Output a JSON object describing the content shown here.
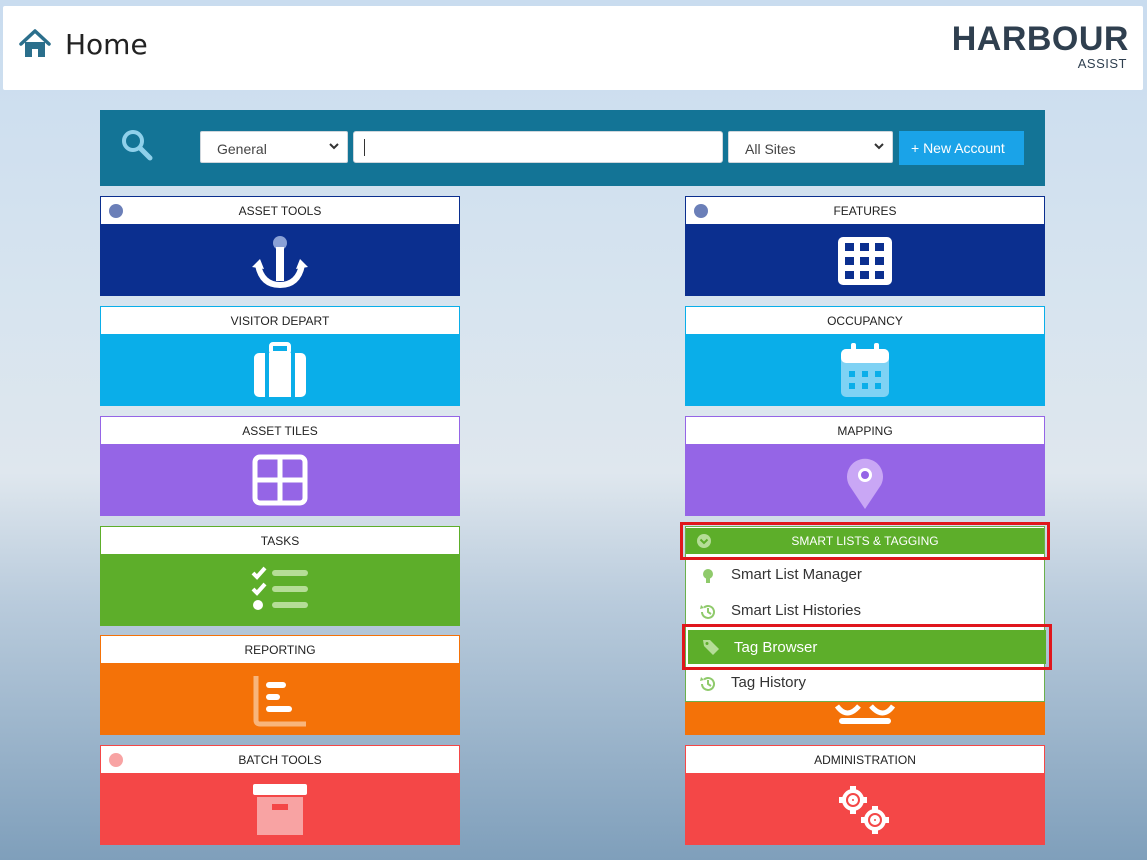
{
  "header": {
    "title": "Home",
    "logo_main": "HARBOUR",
    "logo_sub": "ASSIST"
  },
  "search": {
    "category": "General",
    "query": "",
    "sites": "All Sites",
    "new_account_label": "+ New Account"
  },
  "tiles": {
    "asset_tools": {
      "label": "ASSET TOOLS",
      "color": "#0b2f8f",
      "icon": "anchor-icon"
    },
    "features": {
      "label": "FEATURES",
      "color": "#0b2f8f",
      "icon": "grid-icon"
    },
    "visitor_depart": {
      "label": "VISITOR DEPART",
      "color": "#0aaee9",
      "icon": "suitcase-icon"
    },
    "occupancy": {
      "label": "OCCUPANCY",
      "color": "#0aaee9",
      "icon": "calendar-icon"
    },
    "asset_tiles": {
      "label": "ASSET TILES",
      "color": "#9565e6",
      "icon": "tiles-icon"
    },
    "mapping": {
      "label": "MAPPING",
      "color": "#9565e6",
      "icon": "map-pin-icon"
    },
    "tasks": {
      "label": "TASKS",
      "color": "#5dae2a",
      "icon": "checklist-icon"
    },
    "reporting": {
      "label": "REPORTING",
      "color": "#f47208",
      "icon": "bar-chart-icon"
    },
    "batch_tools": {
      "label": "BATCH TOOLS",
      "color": "#f44747",
      "icon": "archive-box-icon"
    },
    "administration": {
      "label": "ADMINISTRATION",
      "color": "#f44747",
      "icon": "gears-icon"
    }
  },
  "smart_lists": {
    "label": "SMART LISTS & TAGGING",
    "items": [
      {
        "label": "Smart List Manager",
        "icon": "lightbulb-icon"
      },
      {
        "label": "Smart List Histories",
        "icon": "history-icon"
      },
      {
        "label": "Tag Browser",
        "icon": "tag-icon"
      },
      {
        "label": "Tag History",
        "icon": "history-icon"
      }
    ]
  }
}
